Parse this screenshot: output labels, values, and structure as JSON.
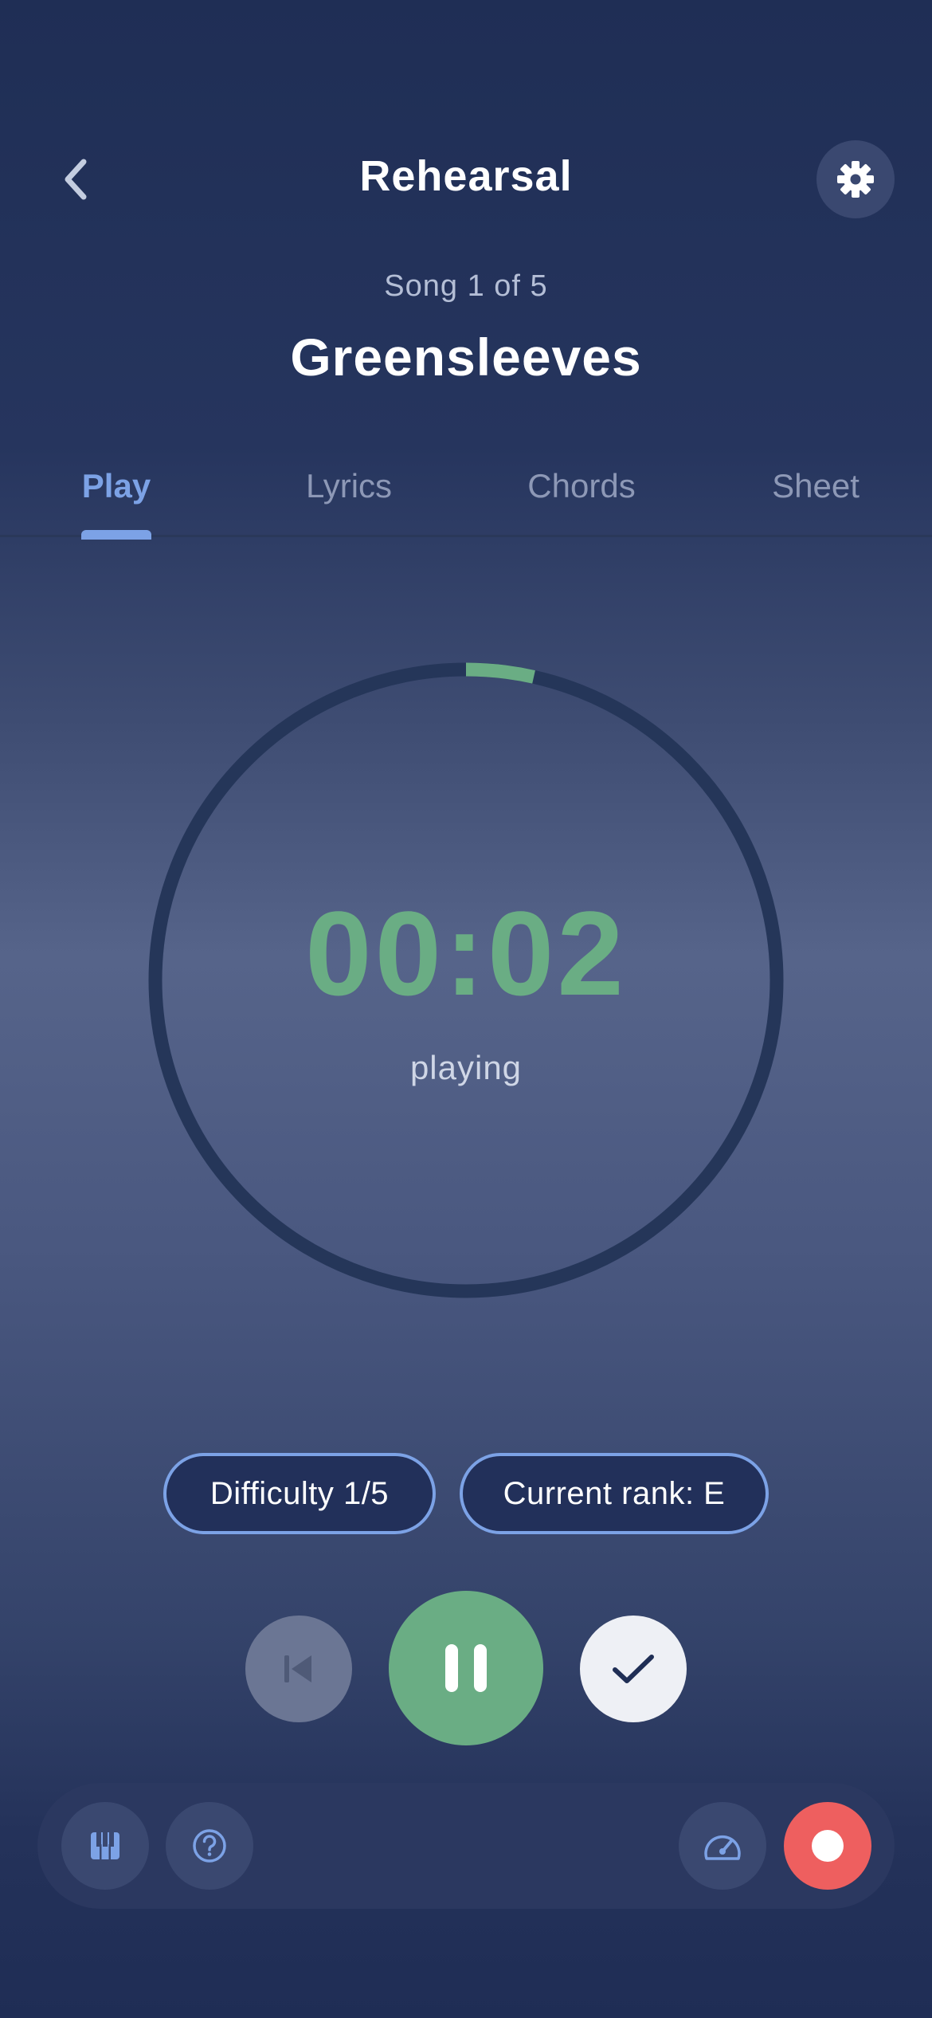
{
  "header": {
    "title": "Rehearsal",
    "back_icon": "chevron-left-icon",
    "settings_icon": "gear-icon"
  },
  "song": {
    "counter": "Song 1 of 5",
    "title": "Greensleeves"
  },
  "tabs": [
    {
      "label": "Play",
      "active": true
    },
    {
      "label": "Lyrics",
      "active": false
    },
    {
      "label": "Chords",
      "active": false
    },
    {
      "label": "Sheet",
      "active": false
    }
  ],
  "timer": {
    "time": "00:02",
    "state": "playing",
    "progress_fraction": 0.035,
    "progress_color": "#6aad84",
    "track_color": "#253659"
  },
  "chips": {
    "difficulty": "Difficulty 1/5",
    "rank": "Current rank: E"
  },
  "controls": {
    "previous_icon": "skip-back-icon",
    "pause_icon": "pause-icon",
    "done_icon": "checkmark-icon"
  },
  "toolbar": {
    "piano_icon": "piano-keys-icon",
    "help_icon": "question-circle-icon",
    "tempo_icon": "speedometer-icon",
    "record_icon": "record-icon"
  },
  "colors": {
    "accent": "#7ca2e6",
    "success": "#6aad84",
    "record": "#ee5f5f",
    "background": "#1f2e55"
  }
}
